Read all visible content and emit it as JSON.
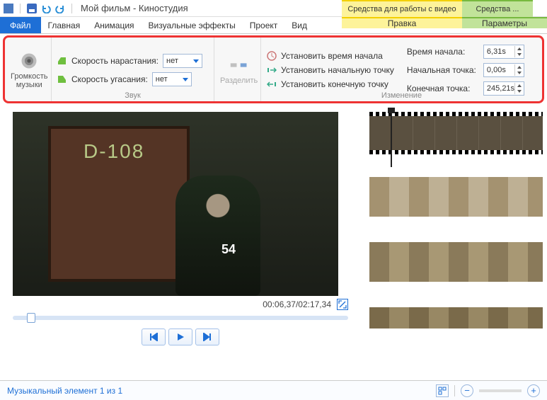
{
  "title": "Мой фильм - Киностудия",
  "tabs": {
    "file": "Файл",
    "home": "Главная",
    "anim": "Анимация",
    "vfx": "Визуальные эффекты",
    "project": "Проект",
    "view": "Вид",
    "ctx_video_hdr": "Средства для работы с видео",
    "ctx_audio_hdr": "Средства ...",
    "ctx_video_tab": "Правка",
    "ctx_audio_tab": "Параметры"
  },
  "ribbon": {
    "volume_label": "Громкость музыки",
    "sound_group": "Звук",
    "fadein_label": "Скорость нарастания:",
    "fadeout_label": "Скорость угасания:",
    "fadein_value": "нет",
    "fadeout_value": "нет",
    "split_label": "Разделить",
    "edit_group": "Изменение",
    "set_start_time": "Установить время начала",
    "set_start_point": "Установить начальную точку",
    "set_end_point": "Установить конечную точку",
    "start_time_label": "Время начала:",
    "start_point_label": "Начальная точка:",
    "end_point_label": "Конечная точка:",
    "start_time_value": "6,31s",
    "start_point_value": "0,00s",
    "end_point_value": "245,21s"
  },
  "preview": {
    "door_text": "D-108",
    "jersey": "54",
    "timecode": "00:06,37/02:17,34"
  },
  "status": {
    "text": "Музыкальный элемент 1 из 1"
  },
  "icons": {
    "minus": "−",
    "plus": "+"
  }
}
